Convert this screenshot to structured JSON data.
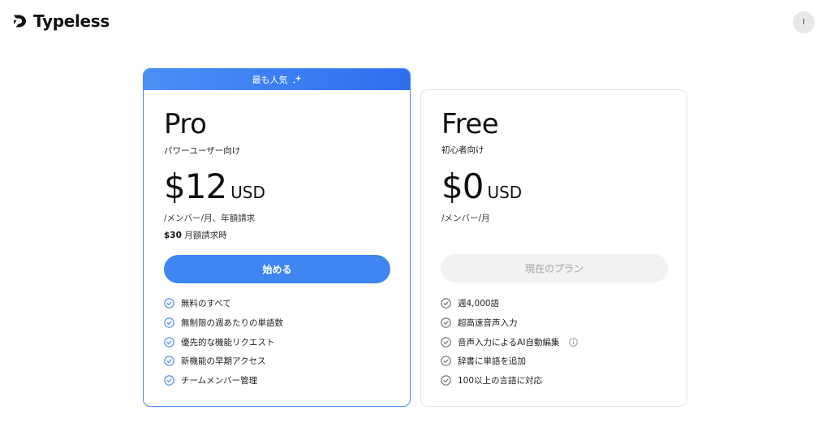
{
  "header": {
    "app_name": "Typeless",
    "avatar_initial": "I"
  },
  "plans": {
    "pro": {
      "badge": "最も人気",
      "name": "Pro",
      "subtitle": "パワーユーザー向け",
      "price": "$12",
      "currency": "USD",
      "price_note": "/メンバー/月、年額請求",
      "monthly_price": "$30",
      "monthly_note": "月額請求時",
      "cta_label": "始める",
      "features": [
        "無料のすべて",
        "無制限の週あたりの単語数",
        "優先的な機能リクエスト",
        "新機能の早期アクセス",
        "チームメンバー管理"
      ]
    },
    "free": {
      "name": "Free",
      "subtitle": "初心者向け",
      "price": "$0",
      "currency": "USD",
      "price_note": "/メンバー/月",
      "cta_label": "現在のプラン",
      "features": [
        "週4,000語",
        "超高速音声入力",
        "音声入力によるAI自動編集",
        "辞書に単語を追加",
        "100以上の言語に対応"
      ]
    }
  },
  "colors": {
    "accent": "#3f86f2",
    "banner_start": "#4a90f5",
    "banner_end": "#2f6ef0",
    "disabled_bg": "#f2f2f2",
    "disabled_text": "#bcbcbc"
  },
  "icons": {
    "logo": "typeless-logo-icon",
    "sparkle": "sparkle-icon",
    "check": "check-circle-icon",
    "info": "info-icon"
  }
}
